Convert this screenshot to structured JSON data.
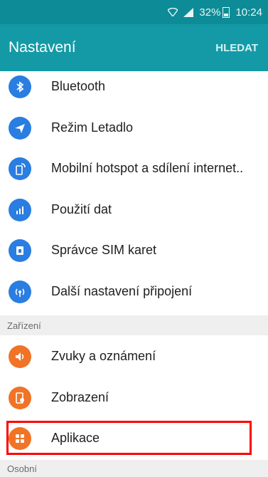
{
  "status_bar": {
    "battery": "32%",
    "time": "10:24",
    "icons": [
      "wifi-icon",
      "signal-icon",
      "battery-icon"
    ]
  },
  "app_bar": {
    "title": "Nastavení",
    "search_label": "HLEDAT"
  },
  "colors": {
    "accent": "#139aa6",
    "status_bar": "#0d8c97",
    "blue_icon": "#2a7de1",
    "orange_icon": "#f07326",
    "highlight": "#ff0000"
  },
  "connections": [
    {
      "label": "Bluetooth",
      "icon": "bluetooth-icon"
    },
    {
      "label": "Režim Letadlo",
      "icon": "airplane-icon"
    },
    {
      "label": "Mobilní hotspot a sdílení internet..",
      "icon": "hotspot-icon"
    },
    {
      "label": "Použití dat",
      "icon": "data-usage-icon"
    },
    {
      "label": "Správce SIM karet",
      "icon": "sim-card-icon"
    },
    {
      "label": "Další nastavení připojení",
      "icon": "more-connections-icon"
    }
  ],
  "sections": {
    "device": "Zařízení",
    "personal": "Osobní"
  },
  "device": [
    {
      "label": "Zvuky a oznámení",
      "icon": "sound-icon"
    },
    {
      "label": "Zobrazení",
      "icon": "display-icon"
    },
    {
      "label": "Aplikace",
      "icon": "apps-icon"
    }
  ]
}
